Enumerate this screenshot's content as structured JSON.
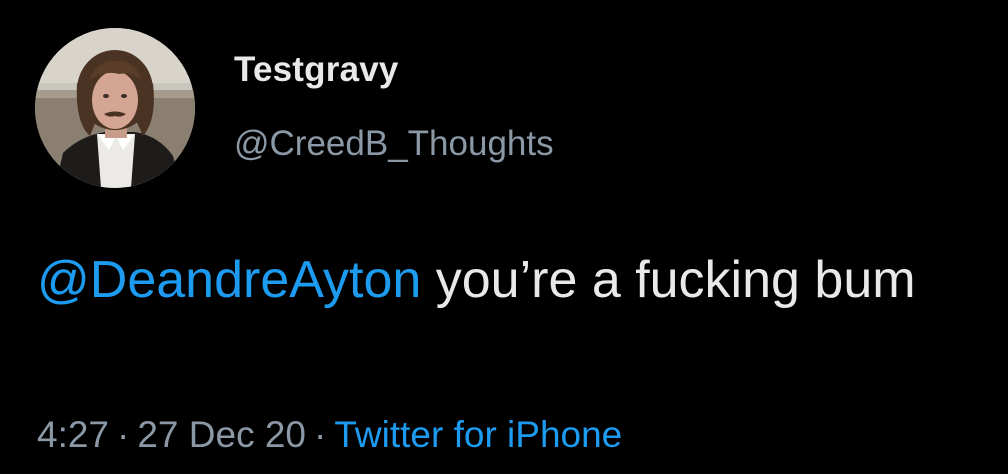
{
  "user": {
    "display_name": "Testgravy",
    "handle": "@CreedB_Thoughts"
  },
  "tweet": {
    "mention": "@DeandreAyton",
    "text": " you’re a fucking bum"
  },
  "meta": {
    "time": "4:27",
    "separator": "·",
    "date": "27 Dec 20",
    "source": "Twitter for iPhone"
  },
  "colors": {
    "background": "#000000",
    "text": "#e7e9ea",
    "secondary": "#8b98a5",
    "accent": "#1d9bf0"
  }
}
